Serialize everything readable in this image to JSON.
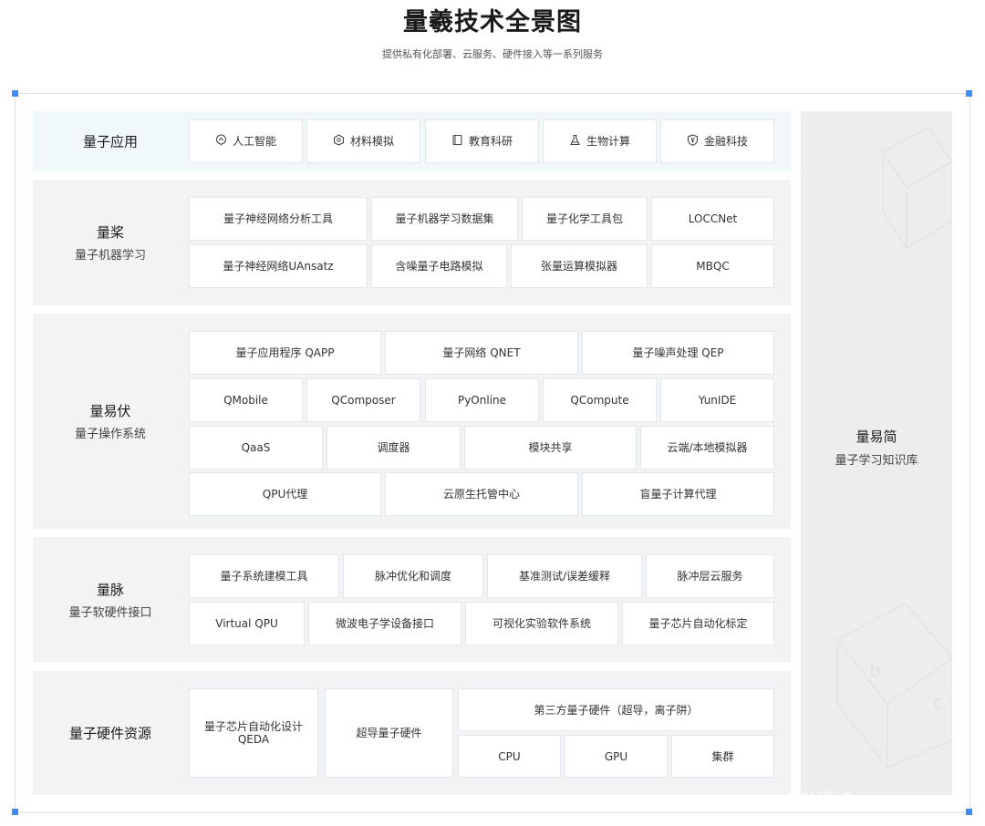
{
  "header": {
    "title": "量羲技术全景图",
    "subtitle": "提供私有化部署、云服务、硬件接入等一系列服务"
  },
  "layers": {
    "app": {
      "name": "量子应用",
      "items": [
        {
          "label": "人工智能",
          "icon": "brain-icon"
        },
        {
          "label": "材料模拟",
          "icon": "hexagon-icon"
        },
        {
          "label": "教育科研",
          "icon": "book-icon"
        },
        {
          "label": "生物计算",
          "icon": "flask-icon"
        },
        {
          "label": "金融科技",
          "icon": "yen-shield-icon"
        }
      ]
    },
    "ml": {
      "name": "量桨",
      "sub": "量子机器学习",
      "row1": [
        "量子神经网络分析工具",
        "量子机器学习数据集",
        "量子化学工具包",
        "LOCCNet"
      ],
      "row2": [
        "量子神经网络UAnsatz",
        "含噪量子电路模拟",
        "张量运算模拟器",
        "MBQC"
      ]
    },
    "os": {
      "name": "量易伏",
      "sub": "量子操作系统",
      "row1": [
        "量子应用程序 QAPP",
        "量子网络 QNET",
        "量子噪声处理 QEP"
      ],
      "row2": [
        "QMobile",
        "QComposer",
        "PyOnline",
        "QCompute",
        "YunIDE"
      ],
      "row3": [
        "QaaS",
        "调度器",
        "模块共享",
        "云端/本地模拟器"
      ],
      "row4": [
        "QPU代理",
        "云原生托管中心",
        "盲量子计算代理"
      ]
    },
    "hw_if": {
      "name": "量脉",
      "sub": "量子软硬件接口",
      "row1": [
        "量子系统建模工具",
        "脉冲优化和调度",
        "基准测试/误差缓释",
        "脉冲层云服务"
      ],
      "row2": [
        "Virtual QPU",
        "微波电子学设备接口",
        "可视化实验软件系统",
        "量子芯片自动化标定"
      ]
    },
    "hw": {
      "name": "量子硬件资源",
      "qeda_line1": "量子芯片自动化设计",
      "qeda_line2": "QEDA",
      "superconducting": "超导量子硬件",
      "third_party": "第三方量子硬件（超导，离子阱）",
      "row2": [
        "CPU",
        "GPU",
        "集群"
      ]
    }
  },
  "sidebar": {
    "name": "量易简",
    "sub": "量子学习知识库"
  },
  "watermark": "…… 社区 @ ……"
}
